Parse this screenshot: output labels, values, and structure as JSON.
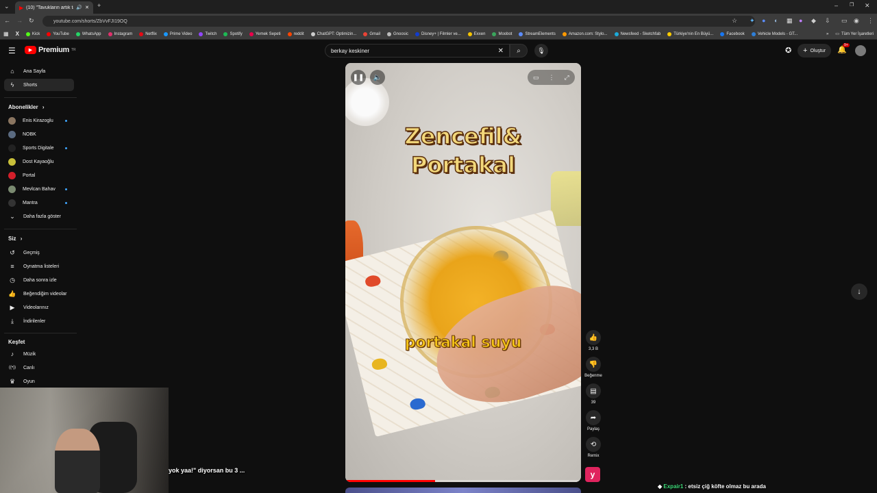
{
  "browser": {
    "tab_title": "(10) \"Tavukların artık taze...",
    "url": "youtube.com/shorts/ZbVvFJI19OQ",
    "bookmarks": [
      {
        "label": "Kick",
        "color": "#53fc18"
      },
      {
        "label": "YouTube",
        "color": "#ff0000"
      },
      {
        "label": "WhatsApp",
        "color": "#25d366"
      },
      {
        "label": "Instagram",
        "color": "#e1306c"
      },
      {
        "label": "Netflix",
        "color": "#e50914"
      },
      {
        "label": "Prime Video",
        "color": "#1a98ff"
      },
      {
        "label": "Twitch",
        "color": "#9146ff"
      },
      {
        "label": "Spotify",
        "color": "#1db954"
      },
      {
        "label": "Yemek Sepeti",
        "color": "#ea004b"
      },
      {
        "label": "reddit",
        "color": "#ff4500"
      },
      {
        "label": "ChatGPT: Optimizin...",
        "color": "#cccccc"
      },
      {
        "label": "Gmail",
        "color": "#ea4335"
      },
      {
        "label": "Gnoosic",
        "color": "#bbbbbb"
      },
      {
        "label": "Disney+ | Filmler ve...",
        "color": "#113ccf"
      },
      {
        "label": "Exxen",
        "color": "#f5c400"
      },
      {
        "label": "Moobot",
        "color": "#3aa55c"
      },
      {
        "label": "StreamElements",
        "color": "#5b8cff"
      },
      {
        "label": "Amazon.com: Stylo...",
        "color": "#ff9900"
      },
      {
        "label": "Newsfeed - Sketchfab",
        "color": "#1caad9"
      },
      {
        "label": "Türkiye'nin En Büyü...",
        "color": "#ffcc00"
      },
      {
        "label": "Facebook",
        "color": "#1877f2"
      },
      {
        "label": "Vehicle Models - GT...",
        "color": "#2e7fd8"
      }
    ],
    "all_bookmarks": "Tüm Yer İşaretleri"
  },
  "header": {
    "logo_text": "Premium",
    "logo_sup": "TR",
    "search_value": "berkay keskiner",
    "create_label": "Oluştur",
    "notif_badge": "9+"
  },
  "sidebar": {
    "main": [
      {
        "label": "Ana Sayfa",
        "icon": "home-icon"
      },
      {
        "label": "Shorts",
        "icon": "shorts-icon"
      }
    ],
    "subs_title": "Abonelikler",
    "subs": [
      {
        "label": "Enis Kirazoglu",
        "color": "#8a7560",
        "live": true
      },
      {
        "label": "NOBK",
        "color": "#5a6a80",
        "live": false
      },
      {
        "label": "Sports Digitale",
        "color": "#222222",
        "live": true
      },
      {
        "label": "Dost Kayaoğlu",
        "color": "#c9c03a",
        "live": false
      },
      {
        "label": "Portal",
        "color": "#d31f2a",
        "live": false
      },
      {
        "label": "Mevlcan Bahav",
        "color": "#7a8a70",
        "live": true
      },
      {
        "label": "Mantra",
        "color": "#333333",
        "live": true
      }
    ],
    "show_more": "Daha fazla göster",
    "you_title": "Siz",
    "you": [
      {
        "label": "Geçmiş",
        "icon": "history-icon"
      },
      {
        "label": "Oynatma listeleri",
        "icon": "playlist-icon"
      },
      {
        "label": "Daha sonra izle",
        "icon": "clock-icon"
      },
      {
        "label": "Beğendiğim videolar",
        "icon": "like-icon"
      },
      {
        "label": "Videolarınız",
        "icon": "video-icon"
      },
      {
        "label": "İndirilenler",
        "icon": "download-icon"
      }
    ],
    "explore_title": "Keşfet",
    "explore": [
      {
        "label": "Müzik",
        "icon": "music-icon"
      },
      {
        "label": "Canlı",
        "icon": "live-icon"
      },
      {
        "label": "Oyun",
        "icon": "gaming-icon"
      }
    ]
  },
  "player": {
    "title_line1": "Zencefil&",
    "title_line2": "Portakal",
    "caption": "portakal suyu",
    "progress": 0.38
  },
  "actions": {
    "likes": "3,3 B",
    "dislike_label": "Beğenme",
    "comments": "39",
    "share_label": "Paylaş",
    "remix_label": "Remix"
  },
  "stream": {
    "ticker": "yok yaa!\" diyorsan bu 3 ...",
    "chat_user": "Expair1",
    "chat_text": ": etsiz çiğ köfte olmaz bu arada"
  }
}
